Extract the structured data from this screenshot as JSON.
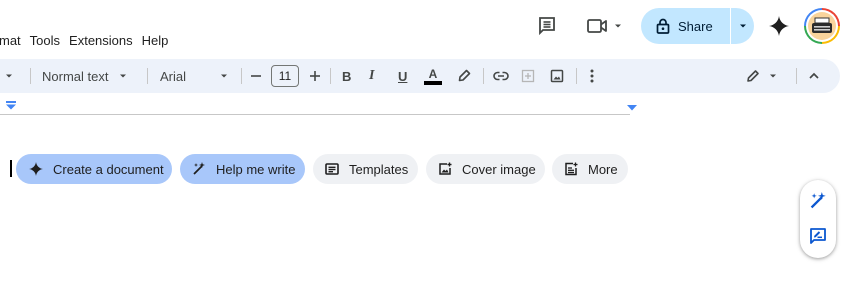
{
  "menu": [
    "mat",
    "Tools",
    "Extensions",
    "Help"
  ],
  "share": {
    "label": "Share"
  },
  "toolbar": {
    "style_label": "Normal text",
    "font_label": "Arial",
    "font_size": "11",
    "bold": "B",
    "italic": "I",
    "underline": "U",
    "text_color": "A"
  },
  "chips": {
    "create_document": "Create a document",
    "help_me_write": "Help me write",
    "templates": "Templates",
    "cover_image": "Cover image",
    "more": "More"
  },
  "colors": {
    "share_bg": "#c2e7ff",
    "toolbar_bg": "#edf2fa",
    "chip_blue": "#a8c7fa",
    "chip_grey": "#eff1f4",
    "accent_blue": "#0b57d0"
  }
}
